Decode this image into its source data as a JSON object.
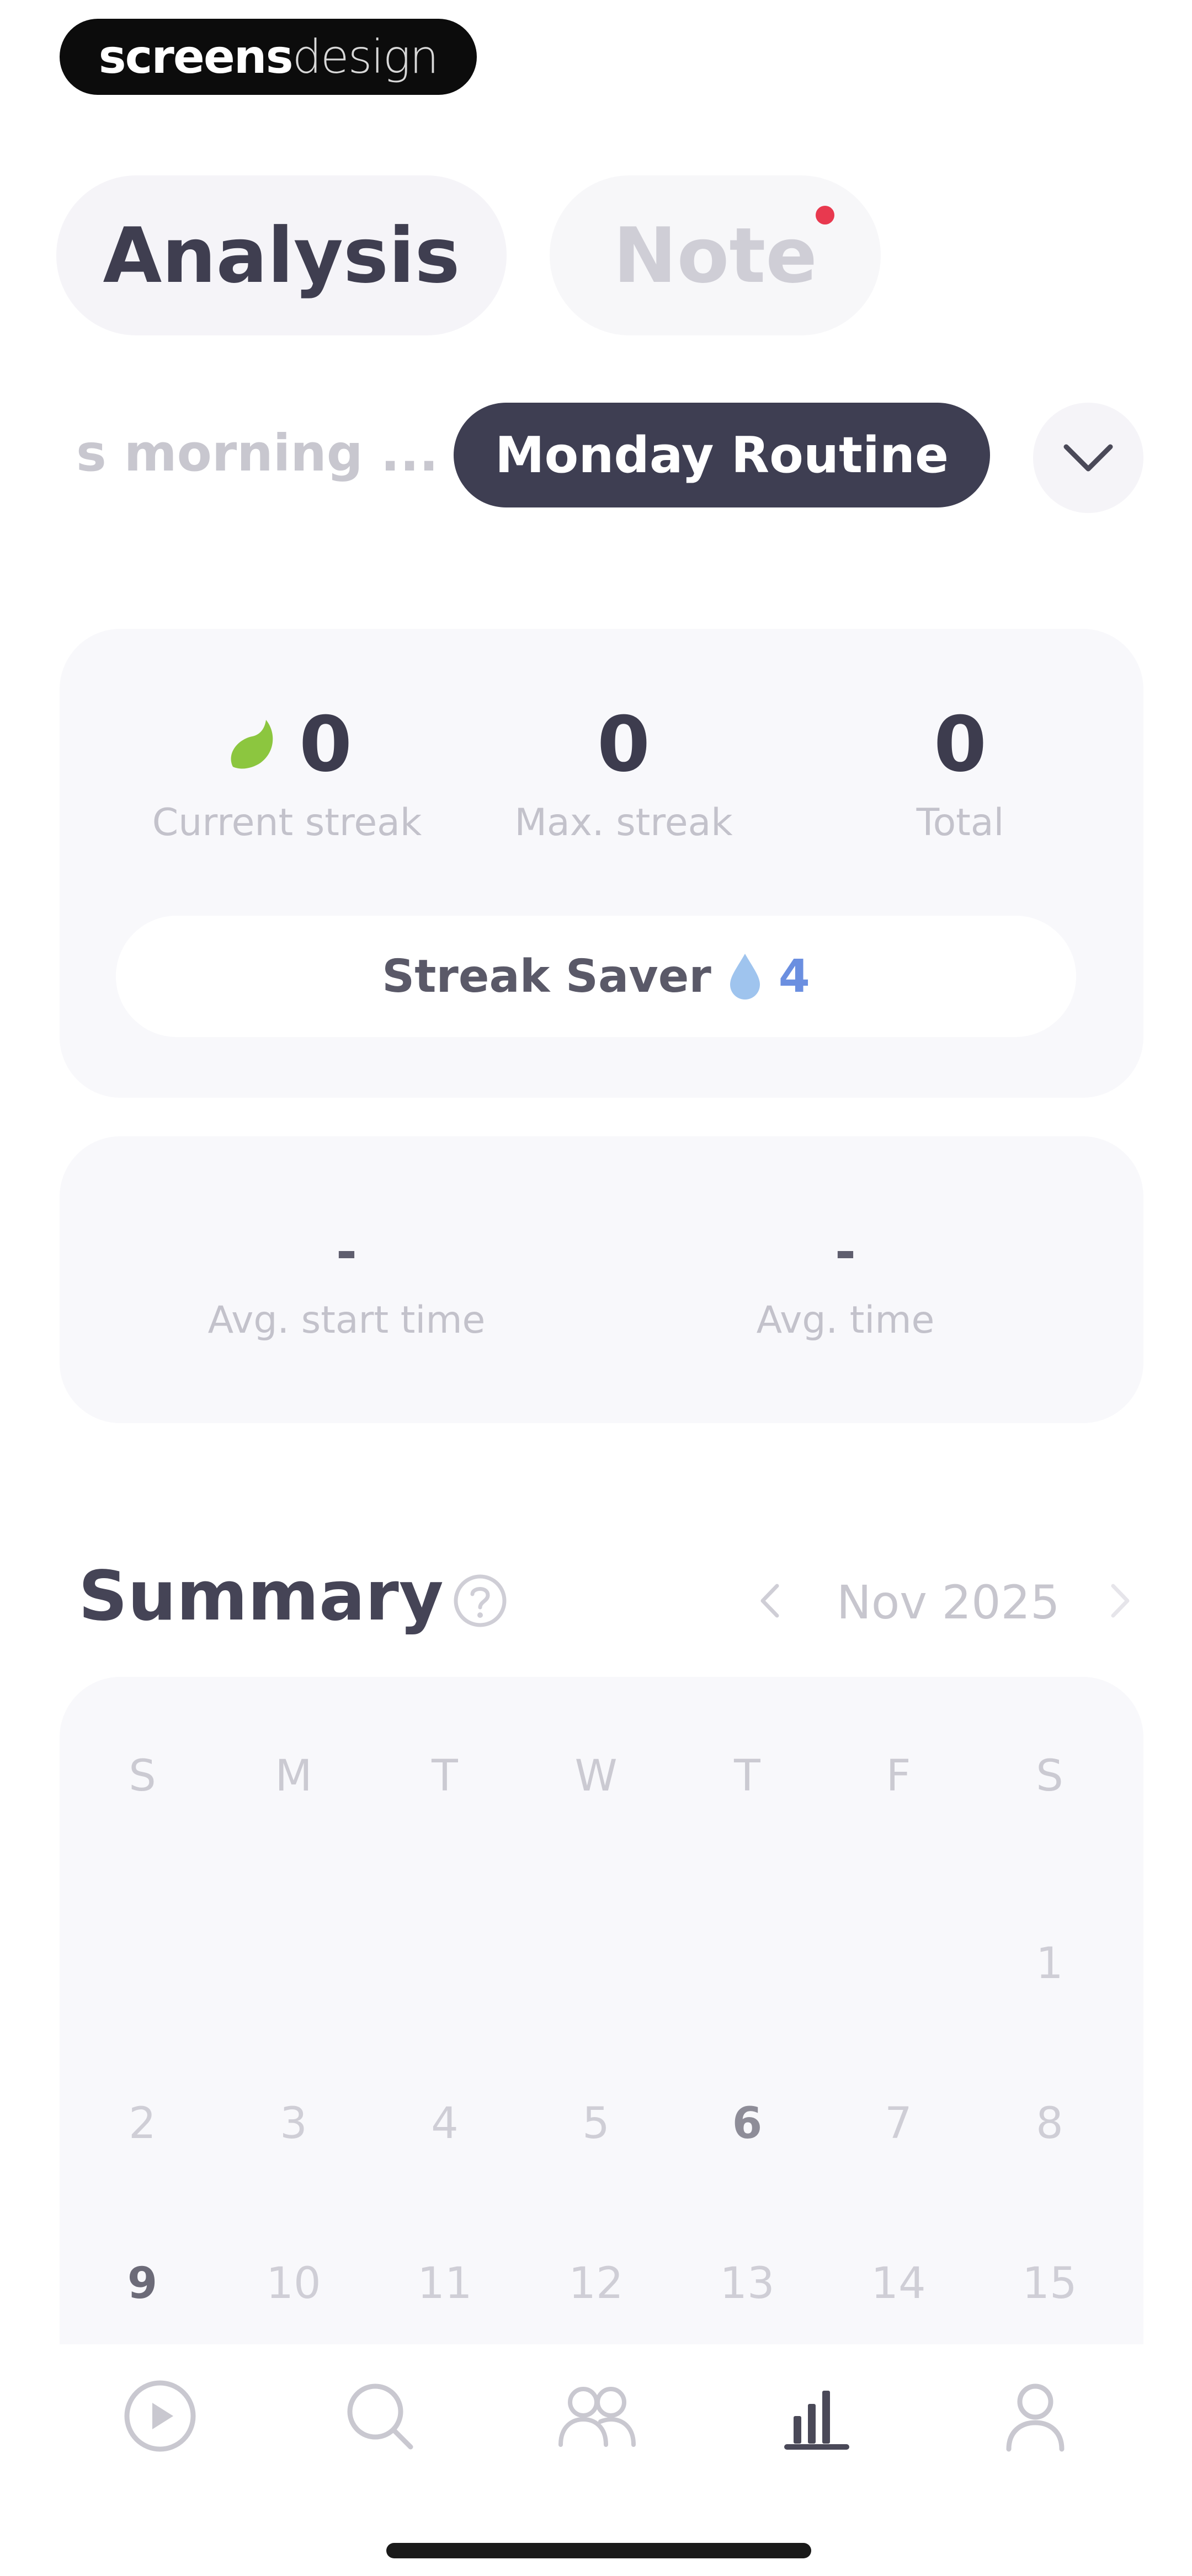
{
  "watermark": {
    "part1": "screens",
    "part2": "design"
  },
  "tabs": {
    "analysis": "Analysis",
    "note": "Note"
  },
  "routine": {
    "previous": "s morning ...",
    "selected": "Monday Routine"
  },
  "stats": {
    "current_streak": {
      "value": "0",
      "label": "Current streak"
    },
    "max_streak": {
      "value": "0",
      "label": "Max. streak"
    },
    "total": {
      "value": "0",
      "label": "Total"
    }
  },
  "streak_saver": {
    "label": "Streak Saver",
    "count": "4"
  },
  "averages": {
    "start_time": {
      "value": "-",
      "label": "Avg. start time"
    },
    "time": {
      "value": "-",
      "label": "Avg. time"
    }
  },
  "summary": {
    "title": "Summary",
    "month": "Nov 2025",
    "weekdays": [
      "S",
      "M",
      "T",
      "W",
      "T",
      "F",
      "S"
    ],
    "week1": [
      "1"
    ],
    "week2": [
      "2",
      "3",
      "4",
      "5",
      "6",
      "7",
      "8"
    ],
    "week3": [
      "9",
      "10",
      "11",
      "12",
      "13",
      "14",
      "15"
    ]
  },
  "colors": {
    "accent_dark": "#3e3e52",
    "streak_green": "#8cc63f",
    "saver_blue": "#6b8fe0",
    "notification_red": "#e8394f"
  },
  "nav": [
    "play-icon",
    "search-icon",
    "community-icon",
    "stats-icon",
    "profile-icon"
  ]
}
